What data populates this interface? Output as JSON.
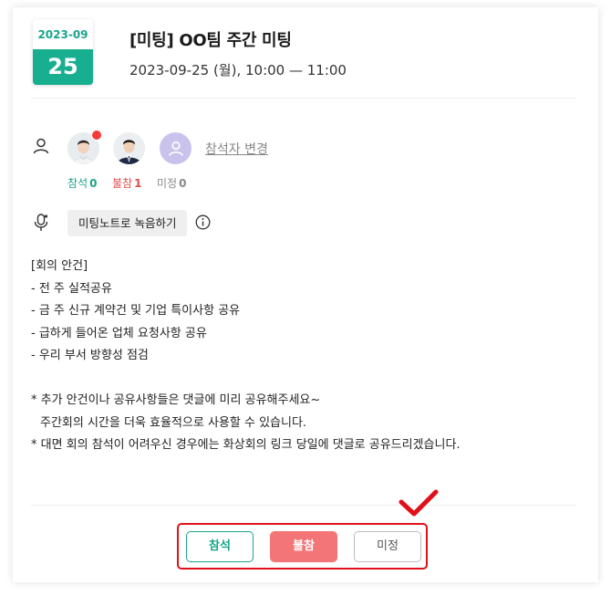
{
  "event": {
    "date_month": "2023-09",
    "date_day": "25",
    "title": "[미팅] OO팀 주간 미팅",
    "time": "2023-09-25 (월), 10:00 — 11:00"
  },
  "attendees": {
    "change_link": "참석자 변경",
    "attend_label": "참석",
    "attend_count": "0",
    "absent_label": "불참",
    "absent_count": "1",
    "undecided_label": "미정",
    "undecided_count": "0"
  },
  "record": {
    "button_label": "미팅노트로 녹음하기"
  },
  "description": {
    "lines": [
      "[회의 안건]",
      "- 전 주 실적공유",
      "- 금 주 신규 계약건 및 기업 특이사항 공유",
      "- 급하게 들어온 업체 요청사항 공유",
      "- 우리 부서 방향성 점검",
      "* 추가 안건이나 공유사항들은 댓글에 미리 공유해주세요~",
      "주간회의 시간을 더욱 효율적으로 사용할 수 있습니다.",
      "* 대면 회의 참석이 어려우신 경우에는 화상회의 링크 당일에 댓글로 공유드리겠습니다."
    ]
  },
  "response": {
    "attend": "참석",
    "absent": "불참",
    "undecided": "미정"
  },
  "colors": {
    "brand_green": "#18ae90",
    "absent_red": "#f47577",
    "highlight_red": "#e0101a"
  },
  "icons": [
    "person-icon",
    "microphone-icon",
    "info-icon",
    "checkmark-icon"
  ]
}
